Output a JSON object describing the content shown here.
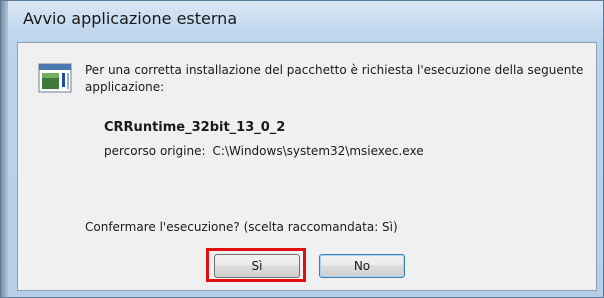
{
  "window": {
    "title": "Avvio applicazione esterna"
  },
  "dialog": {
    "icon": "application-window-icon",
    "message": "Per una corretta installazione del pacchetto è richiesta l'esecuzione della seguente applicazione:",
    "app_name": "CRRuntime_32bit_13_0_2",
    "path_label": "percorso origine:",
    "path_value": "C:\\Windows\\system32\\msiexec.exe",
    "confirm_text": "Confermare l'esecuzione? (scelta raccomandata: Sì)"
  },
  "buttons": {
    "yes_label": "Sì",
    "no_label": "No"
  },
  "colors": {
    "highlight_box": "#e01010",
    "titlebar": "#c6daf0",
    "client_background": "#f0f0f0"
  }
}
